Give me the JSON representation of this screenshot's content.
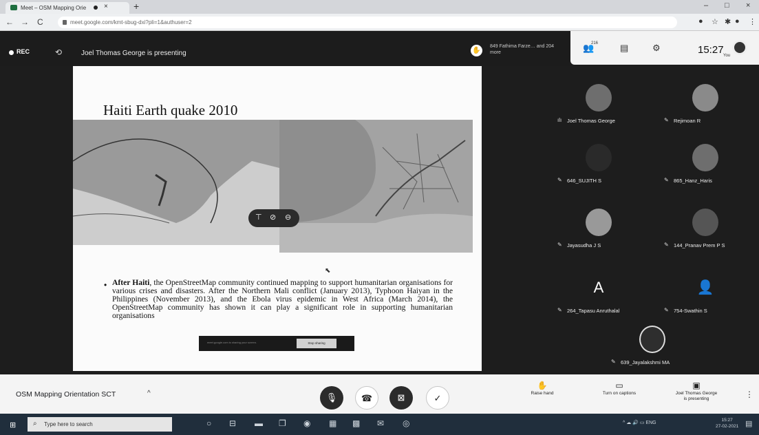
{
  "browser": {
    "tab_title": "Meet – OSM Mapping Orie",
    "tab_close": "×",
    "new_tab": "+",
    "url": "meet.google.com/kmt-sbug-dxi?pli=1&authuser=2",
    "back": "←",
    "forward": "→",
    "reload": "C",
    "minimize": "–",
    "maximize": "□",
    "close": "×"
  },
  "meet_header": {
    "rec_label": "REC",
    "presenting_text": "Joel Thomas George is presenting",
    "raised_hand_names": "849 Fathima Farze… and 204 more",
    "people_count": "216",
    "clock": "15:27",
    "you_label": "You"
  },
  "slide": {
    "title": "Haiti Earth quake 2010",
    "bullet_lead": "After Haiti",
    "bullet_body": ", the OpenStreetMap community continued mapping to support humanitarian organisations for various crises and disasters. After the Northern Mali conflict (January 2013), Typhoon Haiyan in the Philippines (November 2013), and the Ebola virus epidemic in West Africa (March 2014), the OpenStreetMap community has shown it can play a significant role in supporting humanitarian organisations",
    "share_banner_text": "meet.google.com is sharing your screen.",
    "stop_sharing": "Stop sharing"
  },
  "participants": [
    {
      "name": "Joel Thomas George",
      "avatar": "photo"
    },
    {
      "name": "Rejimoan R",
      "avatar": "photo"
    },
    {
      "name": "646_SUJITH S",
      "avatar": "photo"
    },
    {
      "name": "865_Hanz_Haris",
      "avatar": "photo"
    },
    {
      "name": "Jayasudha J S",
      "avatar": "photo"
    },
    {
      "name": "144_Pranav Prem P S",
      "avatar": "photo"
    },
    {
      "name": "264_Tapasu Anruthalal",
      "avatar": "A"
    },
    {
      "name": "754-Swathin S",
      "avatar": "person-icon"
    },
    {
      "name": "639_Jayalakshmi MA",
      "avatar": "photo"
    }
  ],
  "bottom_bar": {
    "meeting_name": "OSM Mapping Orientation SCT",
    "raise_hand": "Raise hand",
    "captions": "Turn on captions",
    "presenting_line1": "Joel Thomas George",
    "presenting_line2": "is presenting"
  },
  "taskbar": {
    "search_placeholder": "Type here to search",
    "language": "ENG",
    "time": "15:27",
    "date": "27-02-2021"
  }
}
